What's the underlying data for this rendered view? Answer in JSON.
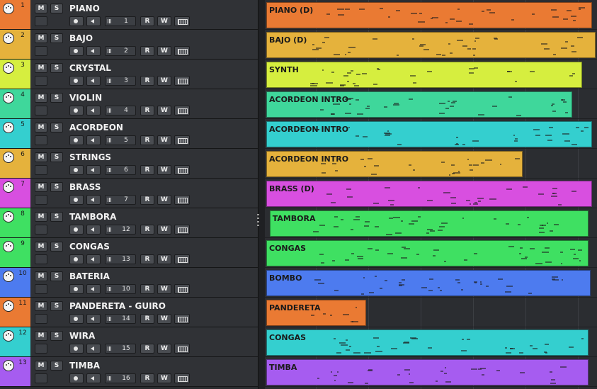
{
  "tracks": [
    {
      "number": "1",
      "name": "PIANO",
      "channel": "1",
      "color": "#ea7a33"
    },
    {
      "number": "2",
      "name": "BAJO",
      "channel": "2",
      "color": "#e5b23c"
    },
    {
      "number": "3",
      "name": "CRYSTAL",
      "channel": "3",
      "color": "#d6ee3f"
    },
    {
      "number": "4",
      "name": "VIOLIN",
      "channel": "4",
      "color": "#3fd79b"
    },
    {
      "number": "5",
      "name": "ACORDEON",
      "channel": "5",
      "color": "#34cfcf"
    },
    {
      "number": "6",
      "name": "STRINGS",
      "channel": "6",
      "color": "#e5b23c"
    },
    {
      "number": "7",
      "name": "BRASS",
      "channel": "7",
      "color": "#d84fe0"
    },
    {
      "number": "8",
      "name": "TAMBORA",
      "channel": "12",
      "color": "#3fe062"
    },
    {
      "number": "9",
      "name": "CONGAS",
      "channel": "13",
      "color": "#3fe062"
    },
    {
      "number": "10",
      "name": "BATERIA",
      "channel": "10",
      "color": "#4d7bef"
    },
    {
      "number": "11",
      "name": "PANDERETA - GUIRO",
      "channel": "14",
      "color": "#ea7a33"
    },
    {
      "number": "12",
      "name": "WIRA",
      "channel": "15",
      "color": "#34cfcf"
    },
    {
      "number": "13",
      "name": "TIMBA",
      "channel": "16",
      "color": "#a65cf0"
    }
  ],
  "button_labels": {
    "mute": "M",
    "solo": "S",
    "read": "R",
    "write": "W"
  },
  "icons": {
    "instrument": "midi-connector-icon",
    "record": "record-icon",
    "monitor": "speaker-icon",
    "channel": "grid-icon",
    "edit": "keyboard-icon"
  },
  "parts": [
    {
      "label": "PIANO (D)",
      "color": "#ea7a33",
      "start": 0.0,
      "end": 0.985
    },
    {
      "label": "BAJO (D)",
      "color": "#e5b23c",
      "start": 0.0,
      "end": 0.995
    },
    {
      "label": "SYNTH",
      "color": "#d6ee3f",
      "start": 0.0,
      "end": 0.955
    },
    {
      "label": "ACORDEON INTRO",
      "color": "#3fd79b",
      "start": 0.0,
      "end": 0.925
    },
    {
      "label": "ACORDEON INTRO",
      "color": "#34cfcf",
      "start": 0.0,
      "end": 0.985
    },
    {
      "label": "ACORDEON INTRO",
      "color": "#e5b23c",
      "start": 0.0,
      "end": 0.775
    },
    {
      "label": "BRASS (D)",
      "color": "#d84fe0",
      "start": 0.0,
      "end": 0.985
    },
    {
      "label": "TAMBORA",
      "color": "#3fe062",
      "start": 0.01,
      "end": 0.975
    },
    {
      "label": "CONGAS",
      "color": "#3fe062",
      "start": 0.0,
      "end": 0.975
    },
    {
      "label": "BOMBO",
      "color": "#4d7bef",
      "start": 0.0,
      "end": 0.98
    },
    {
      "label": "PANDERETA",
      "color": "#ea7a33",
      "start": 0.0,
      "end": 0.305
    },
    {
      "label": "CONGAS",
      "color": "#34cfcf",
      "start": 0.0,
      "end": 0.975
    },
    {
      "label": "TIMBA",
      "color": "#a65cf0",
      "start": 0.0,
      "end": 0.975
    }
  ]
}
